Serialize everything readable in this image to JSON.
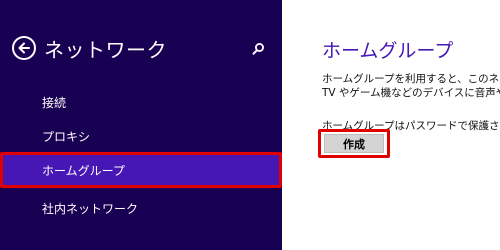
{
  "sidebar": {
    "title": "ネットワーク",
    "items": [
      {
        "label": "接続"
      },
      {
        "label": "プロキシ"
      },
      {
        "label": "ホームグループ"
      },
      {
        "label": "社内ネットワーク"
      }
    ]
  },
  "main": {
    "title": "ホームグループ",
    "description_line1": "ホームグループを利用すると、このネットワーク",
    "description_line2": "TV やゲーム機などのデバイスに音声や映像を",
    "description_line3": "ホームグループはパスワードで保護され、共有",
    "create_label": "作成"
  },
  "colors": {
    "sidebar_bg": "#180052",
    "selected_bg": "#4617b4",
    "highlight_border": "#e00000",
    "title_accent": "#4617b4"
  }
}
